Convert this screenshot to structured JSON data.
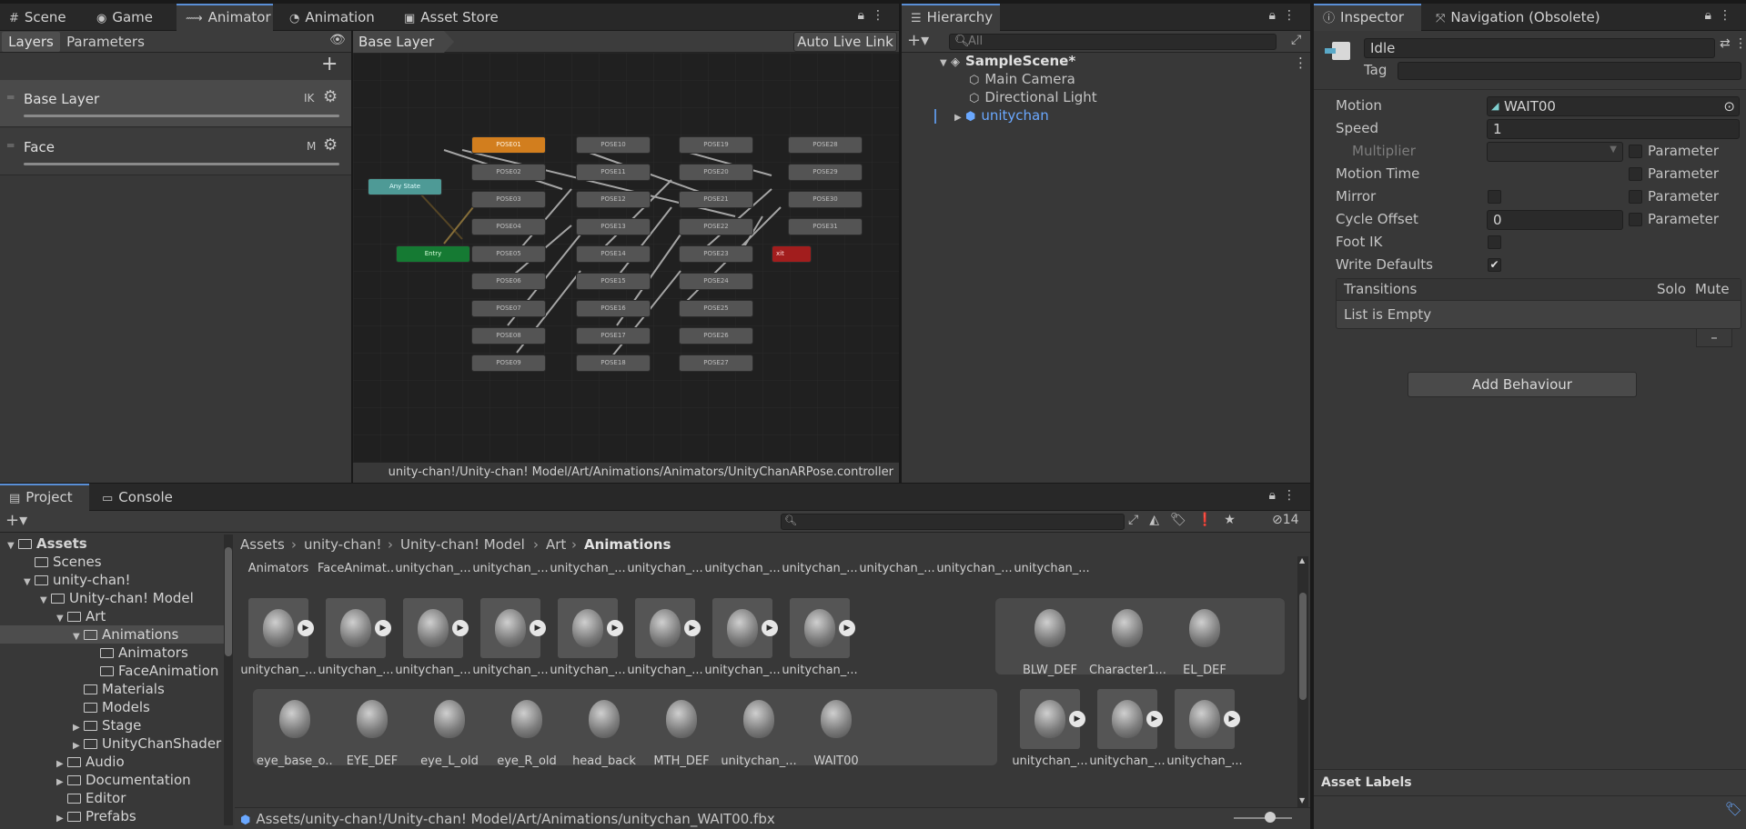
{
  "top_tabs": {
    "scene": "Scene",
    "game": "Game",
    "animator": "Animator",
    "animation": "Animation",
    "asset_store": "Asset Store"
  },
  "animator": {
    "layers_tab": "Layers",
    "parameters_tab": "Parameters",
    "breadcrumb": "Base Layer",
    "auto_live_link": "Auto Live Link",
    "layers": [
      {
        "name": "Base Layer",
        "badge": "IK"
      },
      {
        "name": "Face",
        "badge": "M"
      }
    ],
    "special_states": {
      "any_state": "Any State",
      "entry": "Entry",
      "exit": "xit"
    },
    "state_columns": [
      [
        "POSE01",
        "POSE02",
        "POSE03",
        "POSE04",
        "POSE05",
        "POSE06",
        "POSE07",
        "POSE08",
        "POSE09"
      ],
      [
        "POSE10",
        "POSE11",
        "POSE12",
        "POSE13",
        "POSE14",
        "POSE15",
        "POSE16",
        "POSE17",
        "POSE18"
      ],
      [
        "POSE19",
        "POSE20",
        "POSE21",
        "POSE22",
        "POSE23",
        "POSE24",
        "POSE25",
        "POSE26",
        "POSE27"
      ],
      [
        "POSE28",
        "POSE29",
        "POSE30",
        "POSE31"
      ]
    ],
    "footer_path": "unity-chan!/Unity-chan! Model/Art/Animations/Animators/UnityChanARPose.controller"
  },
  "hierarchy": {
    "tab": "Hierarchy",
    "search_placeholder": "All",
    "scene": "SampleScene*",
    "items": [
      "Main Camera",
      "Directional Light",
      "unitychan"
    ]
  },
  "inspector": {
    "tab": "Inspector",
    "nav_tab": "Navigation (Obsolete)",
    "name": "Idle",
    "tag_label": "Tag",
    "fields": {
      "motion_label": "Motion",
      "motion_value": "WAIT00",
      "speed_label": "Speed",
      "speed_value": "1",
      "multiplier_label": "Multiplier",
      "motion_time_label": "Motion Time",
      "mirror_label": "Mirror",
      "cycle_offset_label": "Cycle Offset",
      "cycle_offset_value": "0",
      "foot_ik_label": "Foot IK",
      "write_defaults_label": "Write Defaults",
      "parameter_label": "Parameter"
    },
    "transitions": {
      "header": "Transitions",
      "solo": "Solo",
      "mute": "Mute",
      "empty": "List is Empty",
      "minus": "–"
    },
    "add_behaviour": "Add Behaviour",
    "asset_labels": "Asset Labels"
  },
  "project": {
    "tab": "Project",
    "console_tab": "Console",
    "hidden_count": "14",
    "breadcrumb": [
      "Assets",
      "unity-chan!",
      "Unity-chan! Model",
      "Art",
      "Animations"
    ],
    "tree": [
      {
        "label": "Assets",
        "indent": 0,
        "arrow": "▼",
        "bold": true
      },
      {
        "label": "Scenes",
        "indent": 1,
        "arrow": ""
      },
      {
        "label": "unity-chan!",
        "indent": 1,
        "arrow": "▼"
      },
      {
        "label": "Unity-chan! Model",
        "indent": 2,
        "arrow": "▼"
      },
      {
        "label": "Art",
        "indent": 3,
        "arrow": "▼"
      },
      {
        "label": "Animations",
        "indent": 4,
        "arrow": "▼",
        "selected": true
      },
      {
        "label": "Animators",
        "indent": 5,
        "arrow": ""
      },
      {
        "label": "FaceAnimation",
        "indent": 5,
        "arrow": ""
      },
      {
        "label": "Materials",
        "indent": 4,
        "arrow": ""
      },
      {
        "label": "Models",
        "indent": 4,
        "arrow": ""
      },
      {
        "label": "Stage",
        "indent": 4,
        "arrow": "▶"
      },
      {
        "label": "UnityChanShader",
        "indent": 4,
        "arrow": "▶"
      },
      {
        "label": "Audio",
        "indent": 3,
        "arrow": "▶"
      },
      {
        "label": "Documentation",
        "indent": 3,
        "arrow": "▶"
      },
      {
        "label": "Editor",
        "indent": 3,
        "arrow": ""
      },
      {
        "label": "Prefabs",
        "indent": 3,
        "arrow": "▶"
      }
    ],
    "row1": [
      "Animators",
      "FaceAnimat...",
      "unitychan_...",
      "unitychan_...",
      "unitychan_...",
      "unitychan_...",
      "unitychan_...",
      "unitychan_...",
      "unitychan_...",
      "unitychan_...",
      "unitychan_..."
    ],
    "row2": [
      "unitychan_...",
      "unitychan_...",
      "unitychan_...",
      "unitychan_...",
      "unitychan_...",
      "unitychan_...",
      "unitychan_...",
      "unitychan_..."
    ],
    "row2_expanded": [
      "BLW_DEF",
      "Character1...",
      "EL_DEF"
    ],
    "row3_expanded": [
      "eye_base_o...",
      "EYE_DEF",
      "eye_L_old",
      "eye_R_old",
      "head_back",
      "MTH_DEF",
      "unitychan_...",
      "WAIT00"
    ],
    "row3": [
      "unitychan_...",
      "unitychan_...",
      "unitychan_..."
    ],
    "footer_path": "Assets/unity-chan!/Unity-chan! Model/Art/Animations/unitychan_WAIT00.fbx"
  }
}
